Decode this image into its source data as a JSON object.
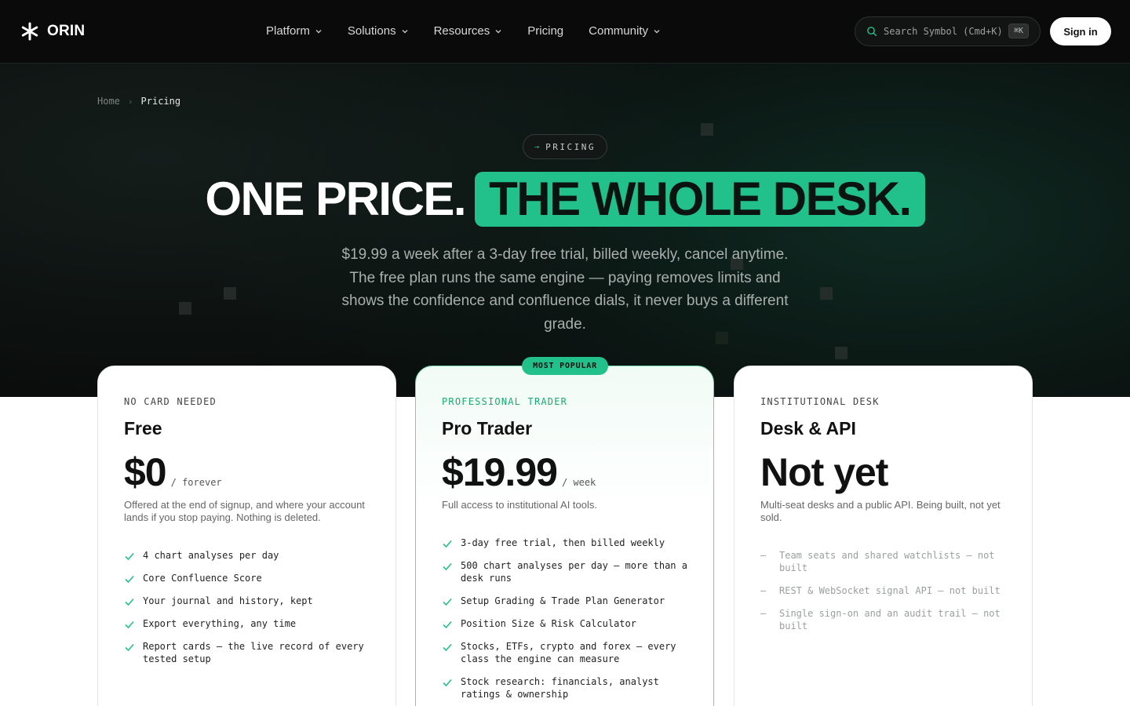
{
  "brand": {
    "name": "ORIN"
  },
  "nav": {
    "items": [
      {
        "label": "Platform",
        "has_menu": true
      },
      {
        "label": "Solutions",
        "has_menu": true
      },
      {
        "label": "Resources",
        "has_menu": true
      },
      {
        "label": "Pricing",
        "has_menu": false
      },
      {
        "label": "Community",
        "has_menu": true
      }
    ],
    "search_placeholder": "Search Symbol (Cmd+K)",
    "search_shortcut": "⌘K",
    "signin_label": "Sign in"
  },
  "breadcrumb": {
    "home": "Home",
    "separator": "›",
    "current": "Pricing"
  },
  "hero": {
    "pill_arrow": "→",
    "pill_label": "PRICING",
    "headline_white": "ONE PRICE.",
    "headline_green": "THE WHOLE DESK.",
    "subtitle": "$19.99 a week after a 3-day free trial, billed weekly, cancel anytime. The free plan runs the same engine — paying removes limits and shows the confidence and confluence dials, it never buys a different grade."
  },
  "colors": {
    "accent": "#22c08a",
    "dark_bg": "#0a0d0c"
  },
  "cards": {
    "badge": "MOST POPULAR",
    "free": {
      "eyebrow": "NO CARD NEEDED",
      "plan": "Free",
      "price": "$0",
      "period": "/ forever",
      "desc": "Offered at the end of signup, and where your account lands if you stop paying. Nothing is deleted.",
      "features": [
        "4 chart analyses per day",
        "Core Confluence Score",
        "Your journal and history, kept",
        "Export everything, any time",
        "Report cards — the live record of every tested setup"
      ]
    },
    "pro": {
      "eyebrow": "PROFESSIONAL TRADER",
      "plan": "Pro Trader",
      "price": "$19.99",
      "period": "/ week",
      "desc": "Full access to institutional AI tools.",
      "features": [
        "3-day free trial, then billed weekly",
        "500 chart analyses per day — more than a desk runs",
        "Setup Grading & Trade Plan Generator",
        "Position Size & Risk Calculator",
        "Stocks, ETFs, crypto and forex — every class the engine can measure",
        "Stock research: financials, analyst ratings & ownership"
      ]
    },
    "inst": {
      "eyebrow": "INSTITUTIONAL DESK",
      "plan": "Desk & API",
      "price": "Not yet",
      "desc": "Multi-seat desks and a public API. Being built, not yet sold.",
      "features": [
        "Team seats and shared watchlists — not built",
        "REST & WebSocket signal API — not built",
        "Single sign-on and an audit trail — not built"
      ]
    }
  }
}
